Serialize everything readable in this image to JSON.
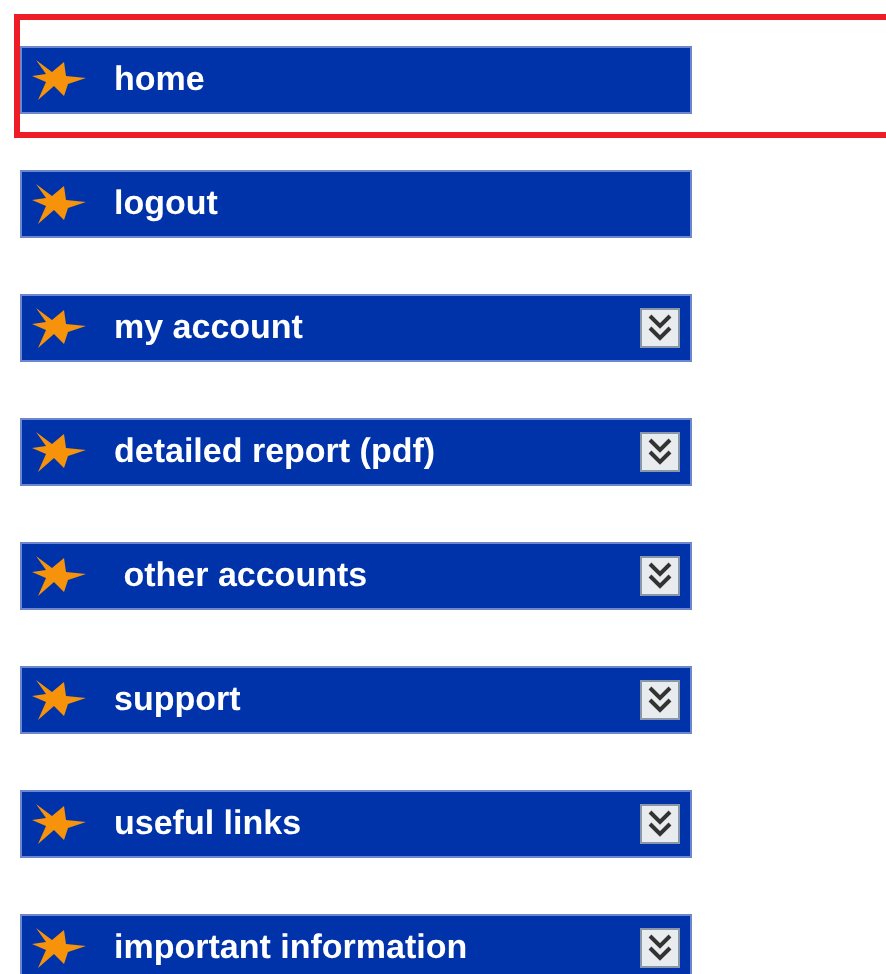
{
  "menu": [
    {
      "label": "home",
      "kind": "link",
      "highlighted": true
    },
    {
      "label": "logout",
      "kind": "link",
      "highlighted": false
    },
    {
      "label": "my account",
      "kind": "expandable",
      "highlighted": false
    },
    {
      "label": "detailed report (pdf)",
      "kind": "expandable",
      "highlighted": false
    },
    {
      "label": " other accounts",
      "kind": "expandable",
      "highlighted": false
    },
    {
      "label": "support",
      "kind": "expandable",
      "highlighted": false
    },
    {
      "label": "useful links",
      "kind": "expandable",
      "highlighted": false
    },
    {
      "label": "important information",
      "kind": "expandable",
      "highlighted": false
    }
  ]
}
